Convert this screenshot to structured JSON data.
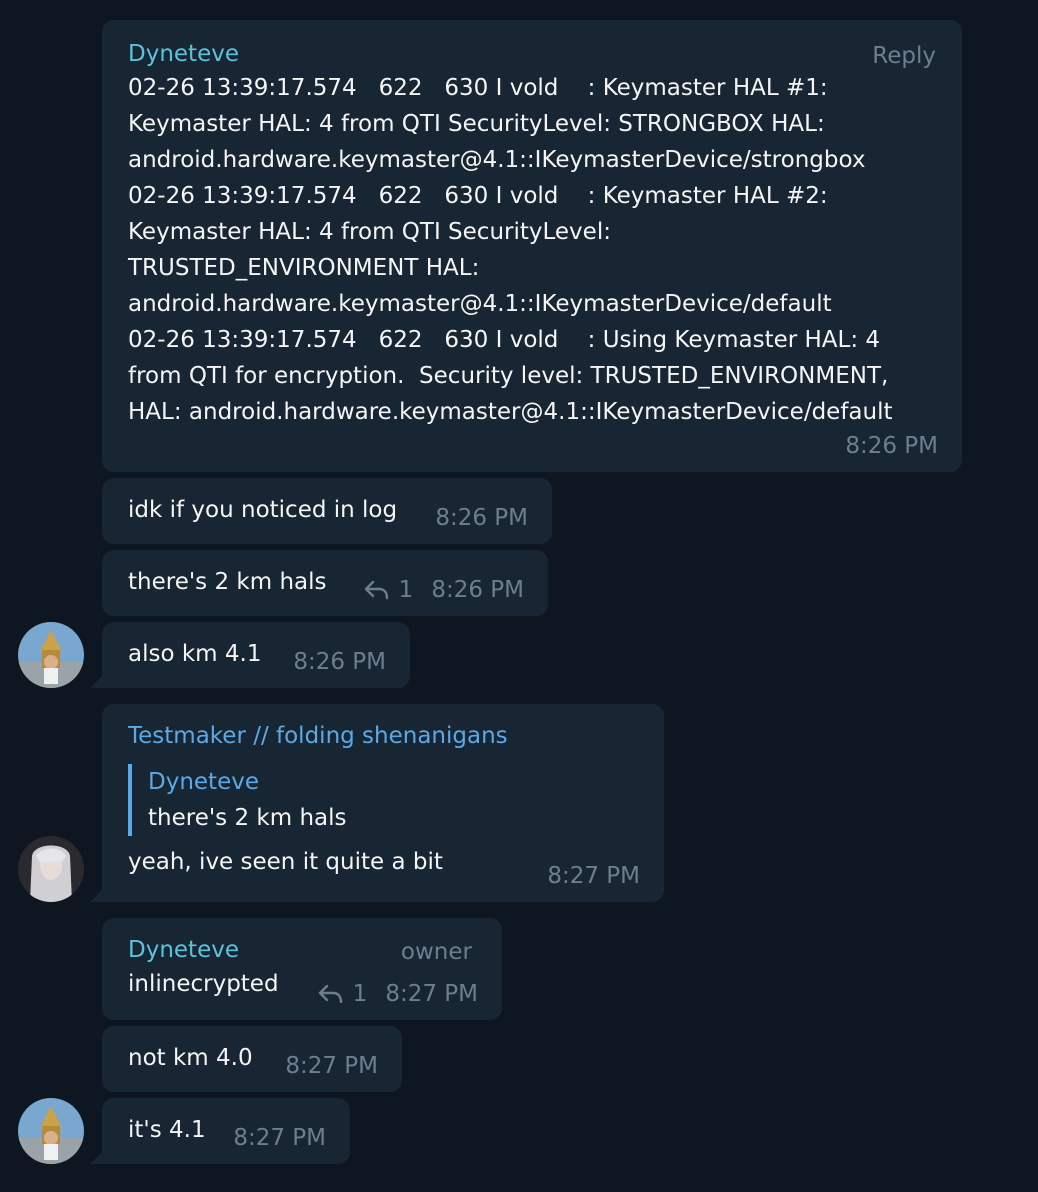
{
  "messages": [
    {
      "sender": "Dyneteve",
      "reply_label": "Reply",
      "lines": [
        "02-26 13:39:17.574   622   630 I vold    : Keymaster HAL #1:",
        "Keymaster HAL: 4 from QTI SecurityLevel: STRONGBOX HAL:",
        "android.hardware.keymaster@4.1::IKeymasterDevice/strongbox",
        "02-26 13:39:17.574   622   630 I vold    : Keymaster HAL #2:",
        "Keymaster HAL: 4 from QTI SecurityLevel:",
        "TRUSTED_ENVIRONMENT HAL:",
        "android.hardware.keymaster@4.1::IKeymasterDevice/default",
        "02-26 13:39:17.574   622   630 I vold    : Using Keymaster HAL: 4",
        "from QTI for encryption.  Security level: TRUSTED_ENVIRONMENT,",
        "HAL: android.hardware.keymaster@4.1::IKeymasterDevice/default"
      ],
      "time": "8:26 PM"
    },
    {
      "text": "idk if you noticed in log",
      "time": "8:26 PM"
    },
    {
      "text": "there's 2 km hals",
      "replies": "1",
      "time": "8:26 PM"
    },
    {
      "text": "also km 4.1",
      "time": "8:26 PM"
    },
    {
      "sender": "Testmaker // folding shenanigans",
      "quote_sender": "Dyneteve",
      "quote_text": "there's 2 km hals",
      "text": "yeah, ive seen it quite a bit",
      "time": "8:27 PM"
    },
    {
      "sender": "Dyneteve",
      "owner_label": "owner",
      "text": "inlinecrypted",
      "replies": "1",
      "time": "8:27 PM"
    },
    {
      "text": "not km 4.0",
      "time": "8:27 PM"
    },
    {
      "text": "it's 4.1",
      "time": "8:27 PM"
    }
  ],
  "colors": {
    "background": "#0e1621",
    "bubble": "#182533",
    "sender_dyneteve": "#5bc4dd",
    "sender_testmaker": "#5aa9e8",
    "meta": "#6d7f8f"
  },
  "icons": [
    "reply-arrow-icon",
    "avatar-dyneteve",
    "avatar-testmaker"
  ]
}
